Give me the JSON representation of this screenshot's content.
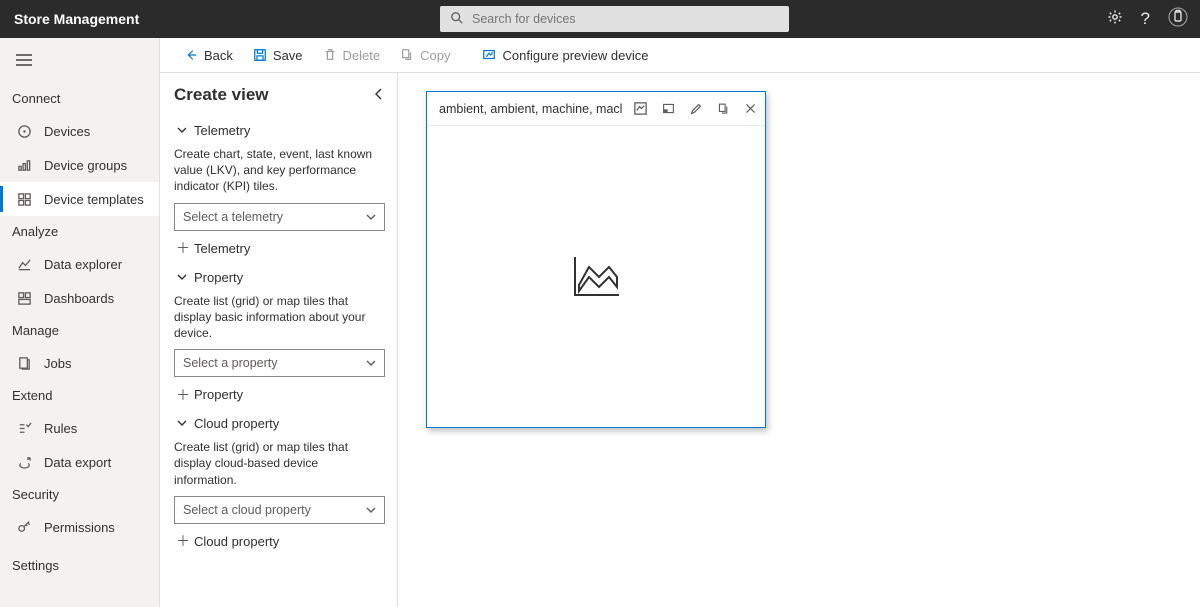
{
  "header": {
    "title": "Store Management",
    "search_placeholder": "Search for devices"
  },
  "nav": {
    "groups": [
      {
        "label": "Connect",
        "items": [
          {
            "id": "devices",
            "label": "Devices"
          },
          {
            "id": "device-groups",
            "label": "Device groups"
          },
          {
            "id": "device-templates",
            "label": "Device templates",
            "selected": true
          }
        ]
      },
      {
        "label": "Analyze",
        "items": [
          {
            "id": "data-explorer",
            "label": "Data explorer"
          },
          {
            "id": "dashboards",
            "label": "Dashboards"
          }
        ]
      },
      {
        "label": "Manage",
        "items": [
          {
            "id": "jobs",
            "label": "Jobs"
          }
        ]
      },
      {
        "label": "Extend",
        "items": [
          {
            "id": "rules",
            "label": "Rules"
          },
          {
            "id": "data-export",
            "label": "Data export"
          }
        ]
      },
      {
        "label": "Security",
        "items": [
          {
            "id": "permissions",
            "label": "Permissions"
          }
        ]
      },
      {
        "label": "Settings",
        "items": []
      }
    ]
  },
  "cmdbar": {
    "back": "Back",
    "save": "Save",
    "delete": "Delete",
    "copy": "Copy",
    "configure": "Configure preview device"
  },
  "panel": {
    "title": "Create view",
    "sections": {
      "telemetry": {
        "header": "Telemetry",
        "desc": "Create chart, state, event, last known value (LKV), and key performance indicator (KPI) tiles.",
        "select_placeholder": "Select a telemetry",
        "add_label": "Telemetry"
      },
      "property": {
        "header": "Property",
        "desc": "Create list (grid) or map tiles that display basic information about your device.",
        "select_placeholder": "Select a property",
        "add_label": "Property"
      },
      "cloud": {
        "header": "Cloud property",
        "desc": "Create list (grid) or map tiles that display cloud-based device information.",
        "select_placeholder": "Select a cloud property",
        "add_label": "Cloud property"
      }
    }
  },
  "tile": {
    "title": "ambient, ambient, machine, macl"
  }
}
